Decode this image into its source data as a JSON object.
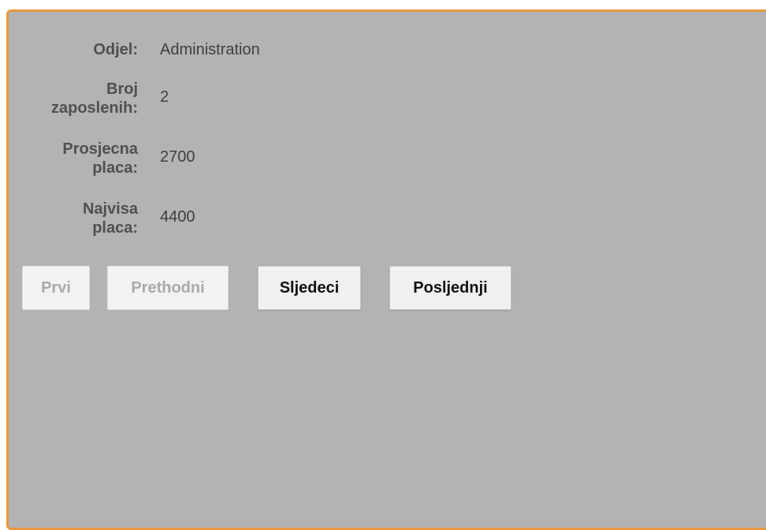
{
  "department": {
    "label": "Odjel:",
    "value": "Administration"
  },
  "employee_count": {
    "label_line1": "Broj",
    "label_line2": "zaposlenih:",
    "value": "2"
  },
  "average_salary": {
    "label_line1": "Prosjecna",
    "label_line2": "placa:",
    "value": "2700"
  },
  "max_salary": {
    "label_line1": "Najvisa",
    "label_line2": "placa:",
    "value": "4400"
  },
  "navigation": {
    "first_label": "Prvi",
    "previous_label": "Prethodni",
    "next_label": "Sljedeci",
    "last_label": "Posljednji",
    "first_enabled": false,
    "previous_enabled": false,
    "next_enabled": true,
    "last_enabled": true
  },
  "colors": {
    "panel_background": "#b3b3b3",
    "panel_border": "#e8983e"
  }
}
